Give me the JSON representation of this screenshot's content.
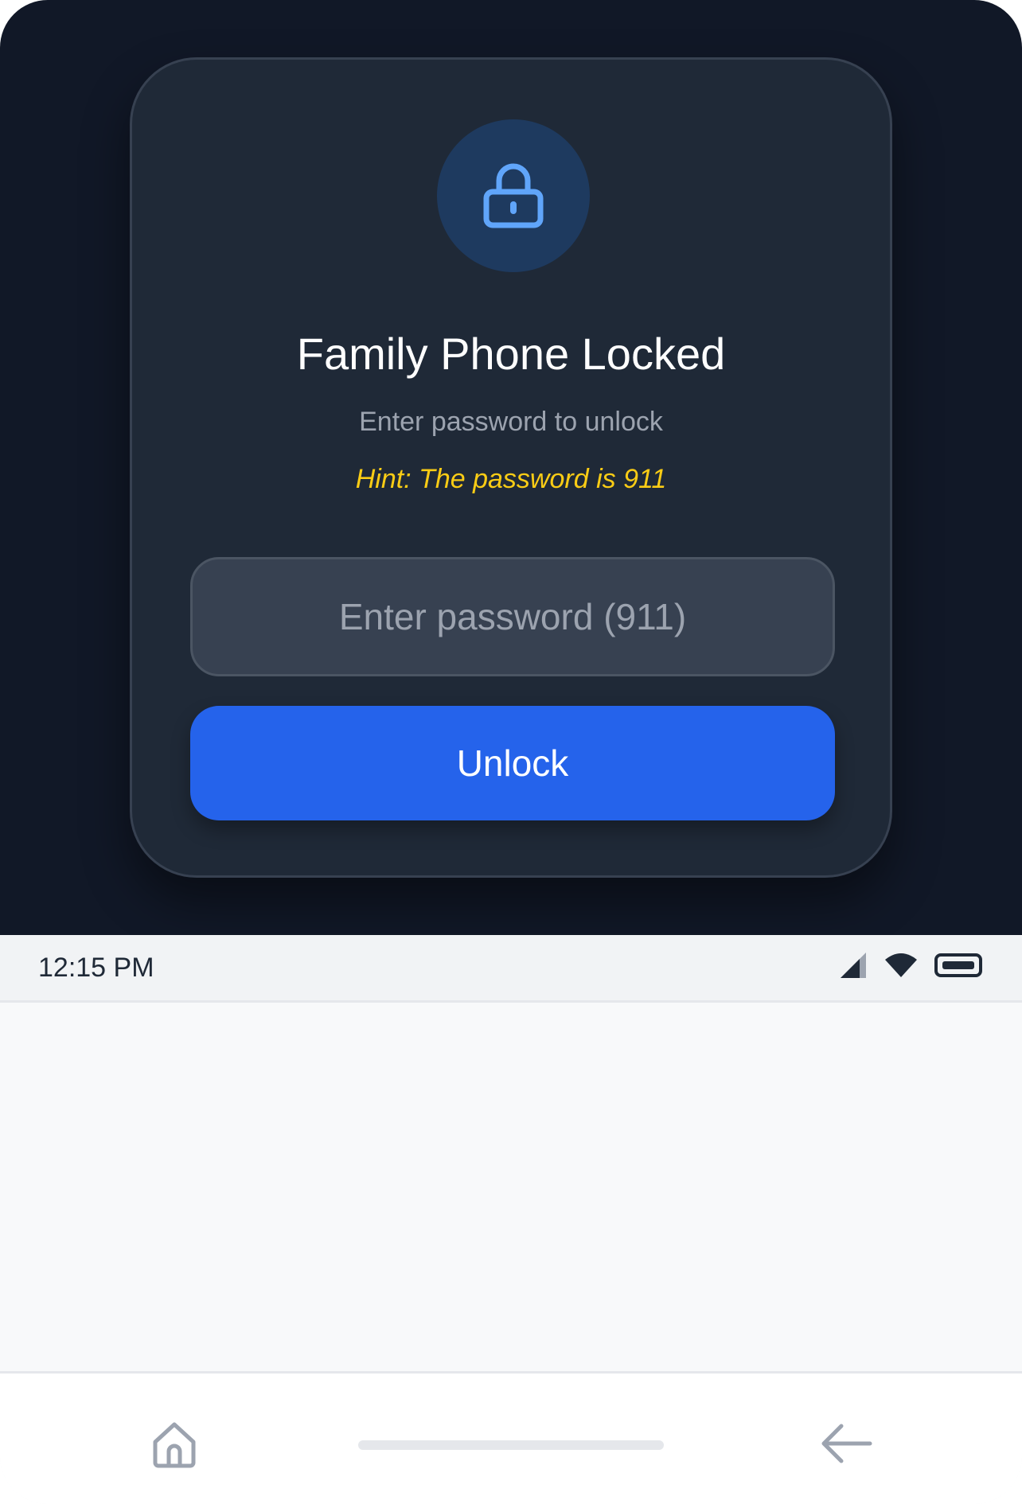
{
  "lock_screen": {
    "title": "Family Phone Locked",
    "subtitle": "Enter password to unlock",
    "hint": "Hint: The password is 911",
    "password_input": {
      "value": "",
      "placeholder": "Enter password (911)"
    },
    "unlock_label": "Unlock",
    "icon": "lock-icon",
    "colors": {
      "background": "#111827",
      "card": "#1f2937",
      "accent": "#2563eb",
      "hint": "#facc15",
      "lock_icon": "#60a5fa"
    }
  },
  "status_bar": {
    "time": "12:15 PM",
    "icons": [
      "signal-icon",
      "wifi-icon",
      "battery-icon"
    ]
  },
  "nav_bar": {
    "icons": [
      "home-icon",
      "home-indicator",
      "back-arrow-icon"
    ]
  }
}
